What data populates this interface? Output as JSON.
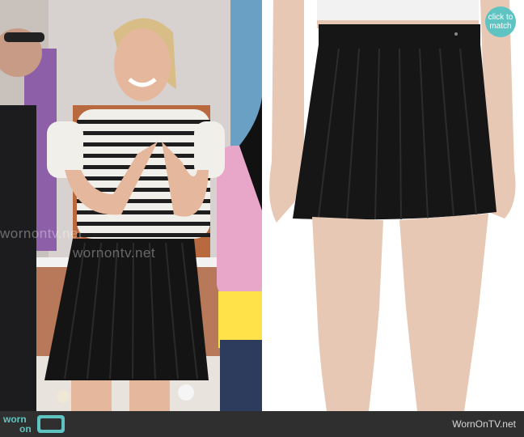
{
  "left_photo": {
    "watermarks": [
      "wornontv.net",
      "wornontv.net"
    ],
    "colors": {
      "skirt": "#141414",
      "stripe": "#1e1e1e",
      "top": "#f1efea",
      "pink_jacket": "#e8a7c9",
      "yellow_top": "#ffe24a"
    }
  },
  "right_photo": {
    "colors": {
      "skirt": "#161616",
      "skin": "#e7c8b4",
      "top": "#f2f2f2"
    }
  },
  "zoom_badge": {
    "line1": "click to",
    "line2": "match",
    "color": "#5fc3c1",
    "icon": "zoom-icon"
  },
  "footer": {
    "logo": {
      "word1": "worn",
      "word2": "on",
      "icon": "tv-icon"
    },
    "site_name": "WornOnTV.net"
  }
}
